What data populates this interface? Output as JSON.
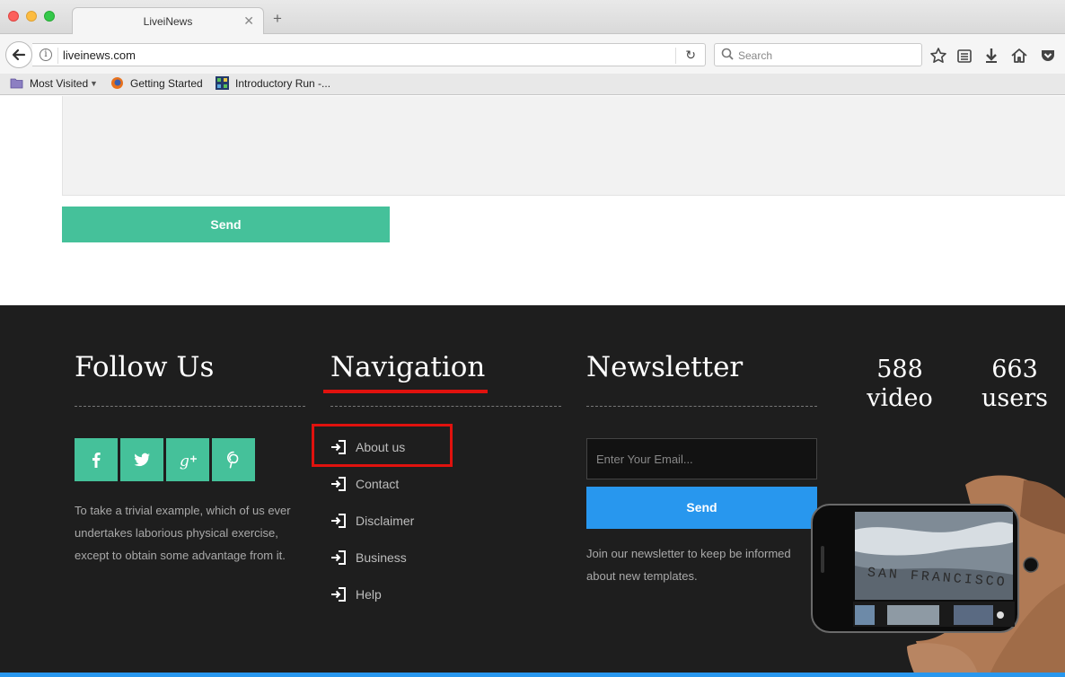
{
  "browser": {
    "tab_title": "LiveiNews",
    "url": "liveinews.com",
    "search_placeholder": "Search",
    "bookmarks": [
      "Most Visited",
      "Getting Started",
      "Introductory Run -..."
    ]
  },
  "page": {
    "form_send_label": "Send"
  },
  "footer": {
    "follow": {
      "heading": "Follow Us",
      "text": "To take a trivial example, which of us ever undertakes laborious physical exercise, except to obtain some advantage from it.",
      "socials": [
        "facebook",
        "twitter",
        "google-plus",
        "pinterest"
      ]
    },
    "navigation": {
      "heading": "Navigation",
      "items": [
        "About us",
        "Contact",
        "Disclaimer",
        "Business",
        "Help"
      ]
    },
    "newsletter": {
      "heading": "Newsletter",
      "email_placeholder": "Enter Your Email...",
      "send_label": "Send",
      "text": "Join our newsletter to keep be informed about new templates."
    },
    "stats": [
      {
        "number": "588",
        "label": "video"
      },
      {
        "number": "663",
        "label": "users"
      }
    ],
    "phone_caption": "SAN FRANCISCO"
  },
  "colors": {
    "accent_green": "#45c19a",
    "accent_blue": "#2897ee",
    "footer_bg": "#1e1e1e",
    "highlight_red": "#e0120e"
  }
}
